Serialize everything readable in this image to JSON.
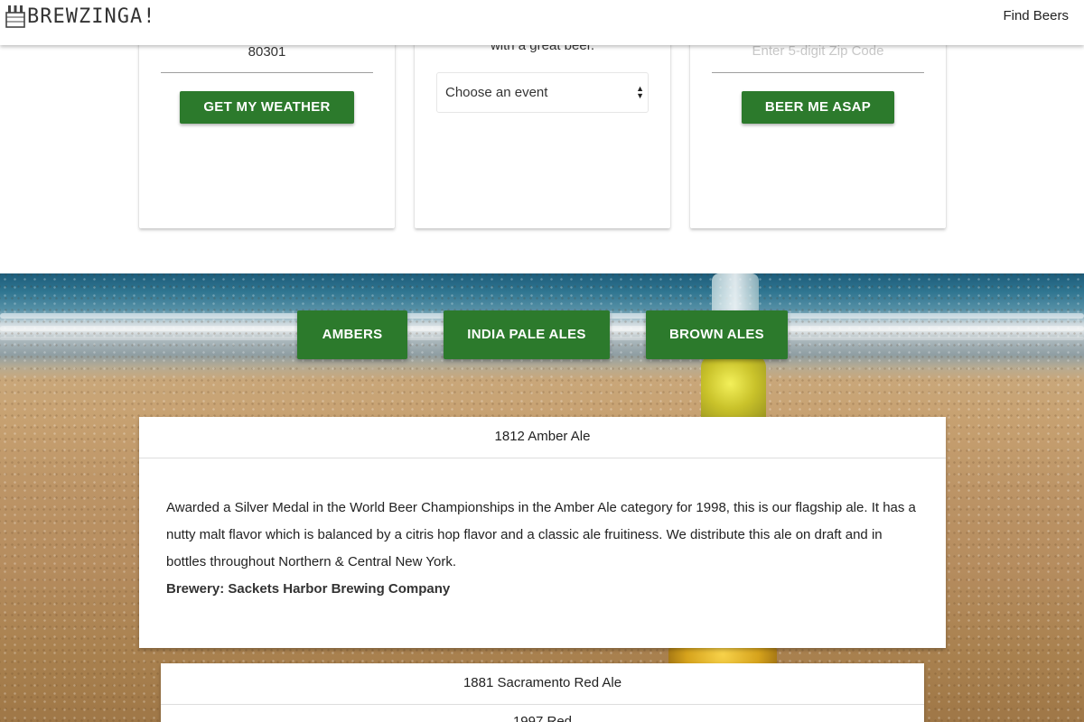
{
  "navbar": {
    "brand": "BREWZINGA!",
    "link_find_beers": "Find Beers"
  },
  "weather_card": {
    "zip_value": "80301",
    "button_label": "GET MY WEATHER"
  },
  "event_card": {
    "description_partial": "with a great beer.",
    "select_value": "Choose an event"
  },
  "asap_card": {
    "zip_placeholder": "Enter 5-digit Zip Code",
    "button_label": "BEER ME ASAP"
  },
  "categories": [
    {
      "label": "AMBERS"
    },
    {
      "label": "INDIA PALE ALES"
    },
    {
      "label": "BROWN ALES"
    }
  ],
  "beers": [
    {
      "name": "1812 Amber Ale",
      "description": "Awarded a Silver Medal in the World Beer Championships in the Amber Ale category for 1998, this is our flagship ale. It has a nutty malt flavor which is balanced by a citris hop flavor and a classic ale fruitiness. We distribute this ale on draft and in bottles throughout Northern & Central New York.",
      "brewery": "Brewery: Sackets Harbor Brewing Company"
    },
    {
      "name": "1881 Sacramento Red Ale",
      "next_partial": "1997 Red"
    }
  ],
  "colors": {
    "accent_green": "#2c7a2c"
  }
}
